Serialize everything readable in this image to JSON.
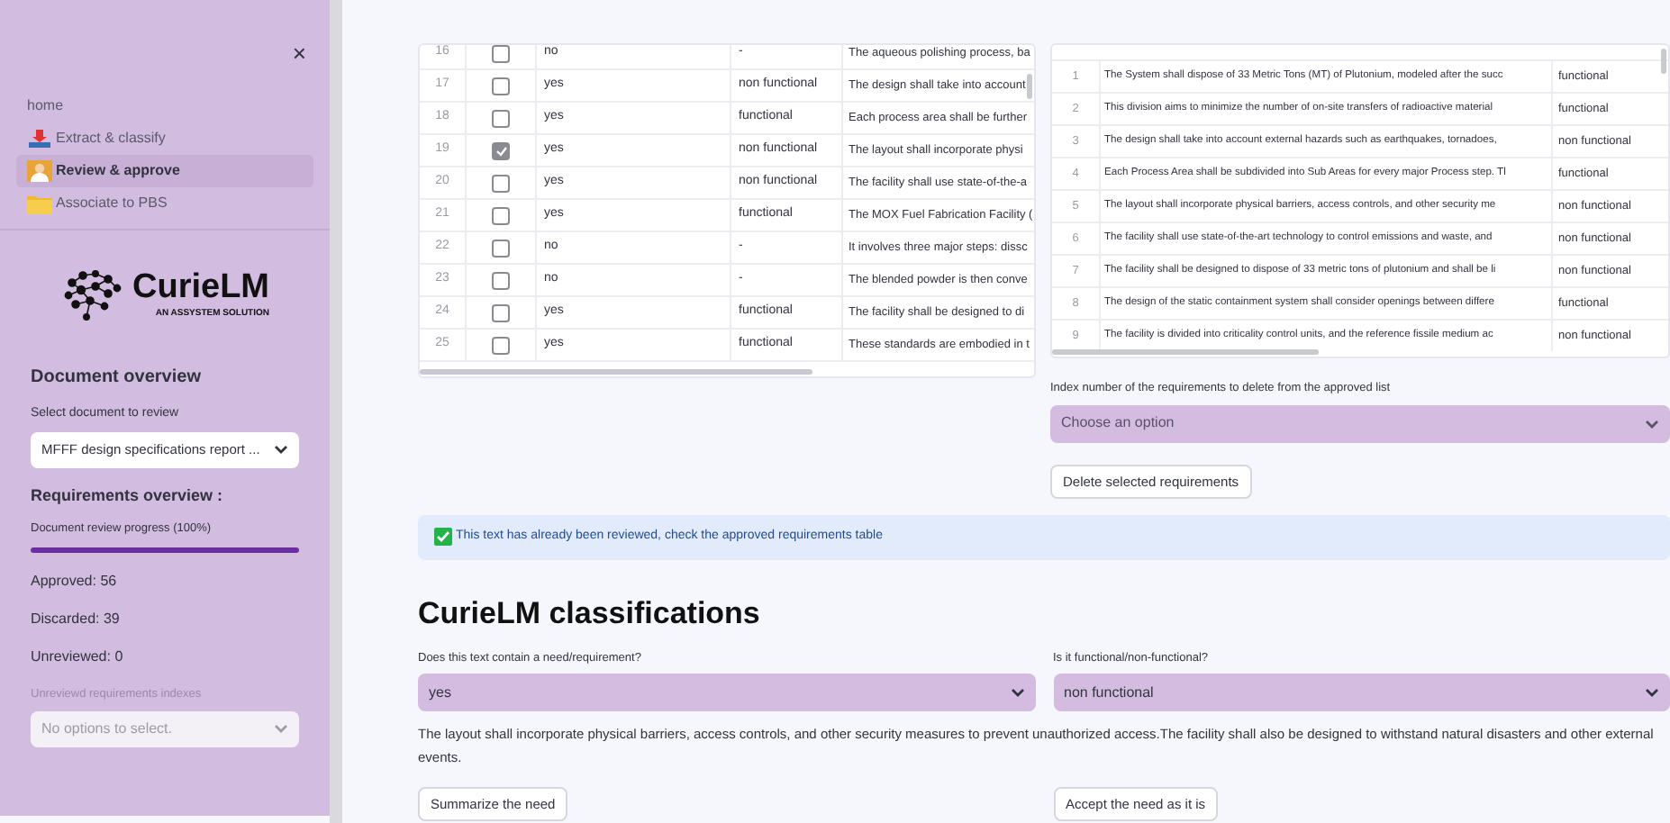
{
  "sidebar": {
    "close": "×",
    "nav": [
      {
        "label": "home",
        "selected": false
      },
      {
        "label": "Extract & classify",
        "selected": false
      },
      {
        "label": "Review & approve",
        "selected": true
      },
      {
        "label": "Associate to PBS",
        "selected": false
      }
    ],
    "logo": {
      "name": "CurieLM",
      "tagline": "AN ASSYSTEM SOLUTION"
    },
    "document_overview": {
      "title": "Document overview",
      "select_label": "Select document to review",
      "select_value": "MFFF design specifications report ..."
    },
    "requirements_overview": {
      "title": "Requirements overview :",
      "progress_label": "Document review progress (100%)",
      "level": 1,
      "approved": "Approved: 56",
      "discarded": "Discarded: 39",
      "unreviewed": "Unreviewed: 0",
      "indexes_label": "Unreviewd requirements indexes",
      "indexes_placeholder": "No options to select.",
      "disabled": true
    }
  },
  "review_table": {
    "rows": [
      {
        "index": "16",
        "checked": false,
        "need": "no",
        "type": "-",
        "text": "The aqueous polishing process, ba"
      },
      {
        "index": "17",
        "checked": false,
        "need": "yes",
        "type": "non functional",
        "text": "The design shall take into account"
      },
      {
        "index": "18",
        "checked": false,
        "need": "yes",
        "type": "functional",
        "text": "Each process area shall be further"
      },
      {
        "index": "19",
        "checked": true,
        "need": "yes",
        "type": "non functional",
        "text": "The layout shall incorporate physi"
      },
      {
        "index": "20",
        "checked": false,
        "need": "yes",
        "type": "non functional",
        "text": "The facility shall use state-of-the-a"
      },
      {
        "index": "21",
        "checked": false,
        "need": "yes",
        "type": "functional",
        "text": "The MOX Fuel Fabrication Facility ("
      },
      {
        "index": "22",
        "checked": false,
        "need": "no",
        "type": "-",
        "text": "It involves three major steps: dissc"
      },
      {
        "index": "23",
        "checked": false,
        "need": "no",
        "type": "-",
        "text": "The blended powder is then conve"
      },
      {
        "index": "24",
        "checked": false,
        "need": "yes",
        "type": "functional",
        "text": "The facility shall be designed to di"
      },
      {
        "index": "25",
        "checked": false,
        "need": "yes",
        "type": "functional",
        "text": "These standards are embodied in t"
      }
    ]
  },
  "approved_table": {
    "rows": [
      {
        "index": "1",
        "text": "The System shall dispose of 33 Metric Tons (MT) of Plutonium, modeled after the succ",
        "type": "functional"
      },
      {
        "index": "2",
        "text": "This division aims to minimize the number of on-site transfers of radioactive material",
        "type": "functional"
      },
      {
        "index": "3",
        "text": "The design shall take into account external hazards such as earthquakes, tornadoes,",
        "type": "non functional"
      },
      {
        "index": "4",
        "text": "Each Process Area shall be subdivided into Sub Areas for every major Process step. Tl",
        "type": "functional"
      },
      {
        "index": "5",
        "text": "The layout shall incorporate physical barriers, access controls, and other security me",
        "type": "non functional"
      },
      {
        "index": "6",
        "text": "The facility shall use state-of-the-art technology to control emissions and waste, and",
        "type": "non functional"
      },
      {
        "index": "7",
        "text": "The facility shall be designed to dispose of 33 metric tons of plutonium and shall be li",
        "type": "non functional"
      },
      {
        "index": "8",
        "text": "The design of the static containment system shall consider openings between differe",
        "type": "functional"
      },
      {
        "index": "9",
        "text": "The facility is divided into criticality control units, and the reference fissile medium ac",
        "type": "non functional"
      }
    ]
  },
  "delete": {
    "label": "Index number of the requirements to delete from the approved list",
    "placeholder": "Choose an option",
    "button": "Delete selected requirements"
  },
  "info": {
    "text": "This text has already been reviewed, check the approved requirements table"
  },
  "classification": {
    "title": "CurieLM classifications",
    "need_label": "Does this text contain a need/requirement?",
    "need_value": "yes",
    "type_label": "Is it functional/non-functional?",
    "type_value": "non functional",
    "text": "The layout shall incorporate physical barriers, access controls, and other security measures to prevent unauthorized access.The facility shall also be designed to withstand natural disasters and other external events.",
    "buttons": [
      "Summarize the need",
      "Accept the need as it is"
    ]
  }
}
